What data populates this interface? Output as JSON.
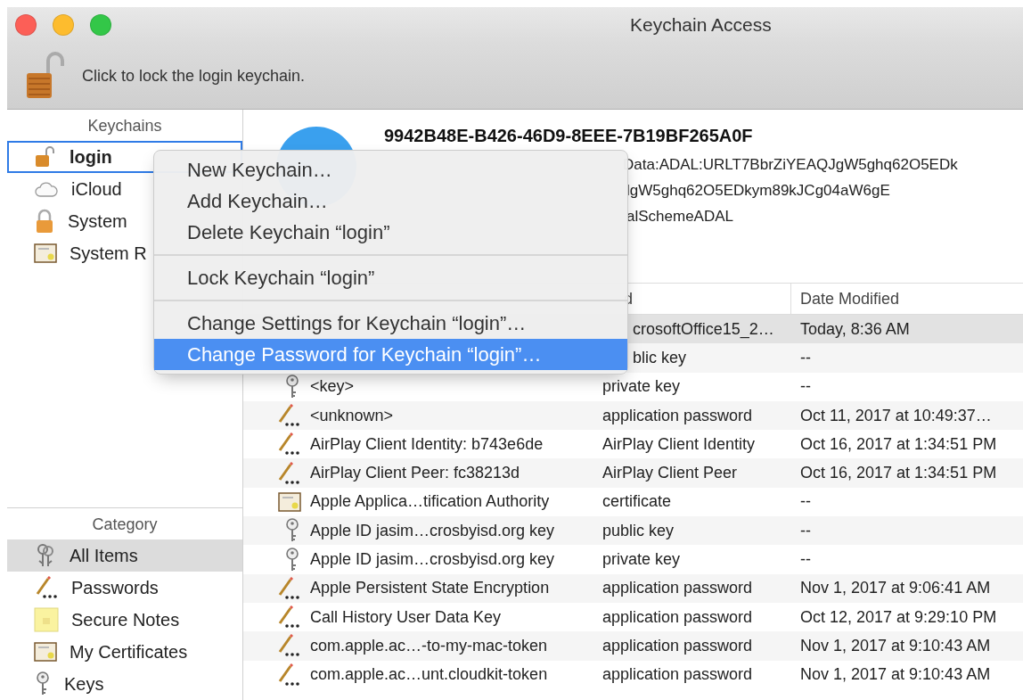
{
  "window": {
    "title": "Keychain Access"
  },
  "toolbar": {
    "lock_text": "Click to lock the login keychain."
  },
  "keychains": {
    "heading": "Keychains",
    "items": [
      {
        "label": "login",
        "kind": "unlocked",
        "selected": true
      },
      {
        "label": "iCloud",
        "kind": "cloud",
        "selected": false
      },
      {
        "label": "System",
        "kind": "locked",
        "selected": false
      },
      {
        "label": "System R",
        "kind": "certificate",
        "selected": false
      }
    ]
  },
  "category": {
    "heading": "Category",
    "items": [
      {
        "label": "All Items",
        "kind": "keys",
        "selected": true
      },
      {
        "label": "Passwords",
        "kind": "password",
        "selected": false
      },
      {
        "label": "Secure Notes",
        "kind": "note",
        "selected": false
      },
      {
        "label": "My Certificates",
        "kind": "certificate",
        "selected": false
      },
      {
        "label": "Keys",
        "kind": "key",
        "selected": false
      }
    ]
  },
  "detail": {
    "title": "9942B48E-B426-46D9-8EEE-7B19BF265A0F",
    "lines": [
      "Data:ADAL:URLT7BbrZiYEAQJgW5ghq62O5EDk",
      "lgW5ghq62O5EDkym89kJCg04aW6gE",
      "alSchemeADAL"
    ]
  },
  "table": {
    "columns": [
      "d",
      "Date Modified"
    ],
    "rows": [
      {
        "column_2": "crosoftOffice15_2…",
        "date": "Today, 8:36 AM",
        "selected": true
      },
      {
        "column_2": "blic key",
        "date": "--",
        "selected": false
      },
      {
        "kind": "key",
        "name": "<key>",
        "column_2": "private key",
        "date": "--",
        "selected": false
      },
      {
        "kind": "password",
        "name": "<unknown>",
        "column_2": "application password",
        "date": "Oct 11, 2017 at 10:49:37…",
        "selected": false
      },
      {
        "kind": "password",
        "name": "AirPlay Client Identity: b743e6de",
        "column_2": "AirPlay Client Identity",
        "date": "Oct 16, 2017 at 1:34:51 PM",
        "selected": false
      },
      {
        "kind": "password",
        "name": "AirPlay Client Peer: fc38213d",
        "column_2": "AirPlay Client Peer",
        "date": "Oct 16, 2017 at 1:34:51 PM",
        "selected": false
      },
      {
        "kind": "certificate",
        "name": "Apple Applica…tification Authority",
        "column_2": "certificate",
        "date": "--",
        "selected": false
      },
      {
        "kind": "key",
        "name": "Apple ID jasim…crosbyisd.org key",
        "column_2": "public key",
        "date": "--",
        "selected": false
      },
      {
        "kind": "key",
        "name": "Apple ID jasim…crosbyisd.org key",
        "column_2": "private key",
        "date": "--",
        "selected": false
      },
      {
        "kind": "password",
        "name": "Apple Persistent State Encryption",
        "column_2": "application password",
        "date": "Nov 1, 2017 at 9:06:41 AM",
        "selected": false
      },
      {
        "kind": "password",
        "name": "Call History User Data Key",
        "column_2": "application password",
        "date": "Oct 12, 2017 at 9:29:10 PM",
        "selected": false
      },
      {
        "kind": "password",
        "name": "com.apple.ac…-to-my-mac-token",
        "column_2": "application password",
        "date": "Nov 1, 2017 at 9:10:43 AM",
        "selected": false
      },
      {
        "kind": "password",
        "name": "com.apple.ac…unt.cloudkit-token",
        "column_2": "application password",
        "date": "Nov 1, 2017 at 9:10:43 AM",
        "selected": false
      }
    ]
  },
  "context_menu": {
    "groups": [
      [
        {
          "label": "New Keychain…",
          "selected": false
        },
        {
          "label": "Add Keychain…",
          "selected": false
        },
        {
          "label": "Delete Keychain “login”",
          "selected": false
        }
      ],
      [
        {
          "label": "Lock Keychain “login”",
          "selected": false
        }
      ],
      [
        {
          "label": "Change Settings for Keychain “login”…",
          "selected": false
        },
        {
          "label": "Change Password for Keychain “login”…",
          "selected": true
        }
      ]
    ]
  }
}
